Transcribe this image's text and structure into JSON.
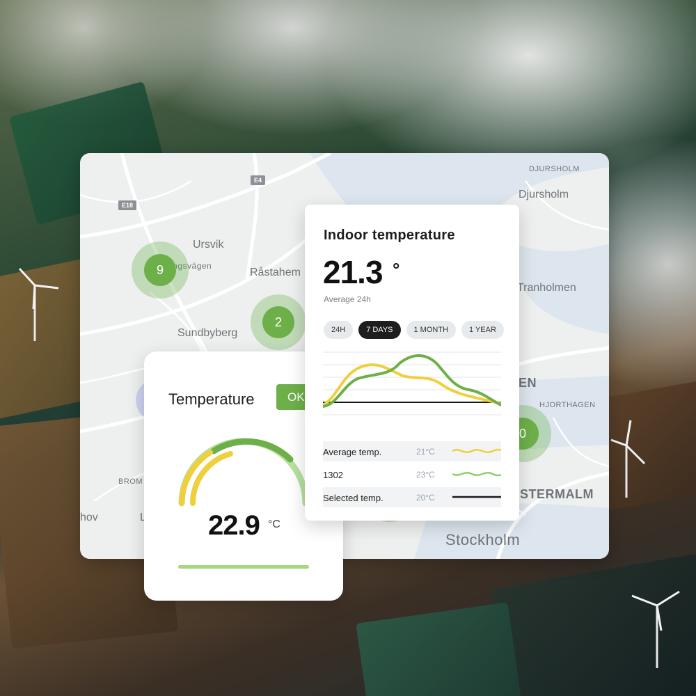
{
  "map": {
    "labels": {
      "ursvik": "Ursvik",
      "pingsvagen": "ingsvägen",
      "rastahem": "Råstahem",
      "sundbyberg": "Sundbyberg",
      "djursholm_caps": "DJURSHOLM",
      "djursholm": "Djursholm",
      "tranholmen": "Tranholmen",
      "en": "EN",
      "hjorthagen": "HJORTHAGEN",
      "ostermalm": "STERMALM",
      "stockholm": "Stockholm",
      "bromi": "BROM",
      "hov": "hov",
      "l": "L"
    },
    "road_signs": {
      "e4": "E4",
      "e18": "E18"
    },
    "clusters": [
      {
        "count": "9"
      },
      {
        "count": "2"
      },
      {
        "count": "0"
      }
    ]
  },
  "temperature_card": {
    "title": "Temperature",
    "status_badge": "OK",
    "value": "22.9",
    "unit": "°C",
    "gauge_level": 0.85
  },
  "indoor_card": {
    "title": "Indoor temperature",
    "value": "21.3",
    "degree": "°",
    "subtitle": "Average 24h",
    "periods": [
      "24H",
      "7 DAYS",
      "1 MONTH",
      "1 YEAR"
    ],
    "active_period": "7 DAYS",
    "legend": [
      {
        "name": "Average temp.",
        "value": "21°C",
        "color": "#f0cf3c"
      },
      {
        "name": "1302",
        "value": "23°C",
        "color": "#8fcf6a"
      },
      {
        "name": "Selected temp.",
        "value": "20°C",
        "color": "#1a1a1a"
      }
    ]
  },
  "colors": {
    "accent_green": "#6db04a",
    "light_green": "#a6d77e",
    "yellow": "#f0cf3c",
    "dark": "#1e1e1e"
  }
}
